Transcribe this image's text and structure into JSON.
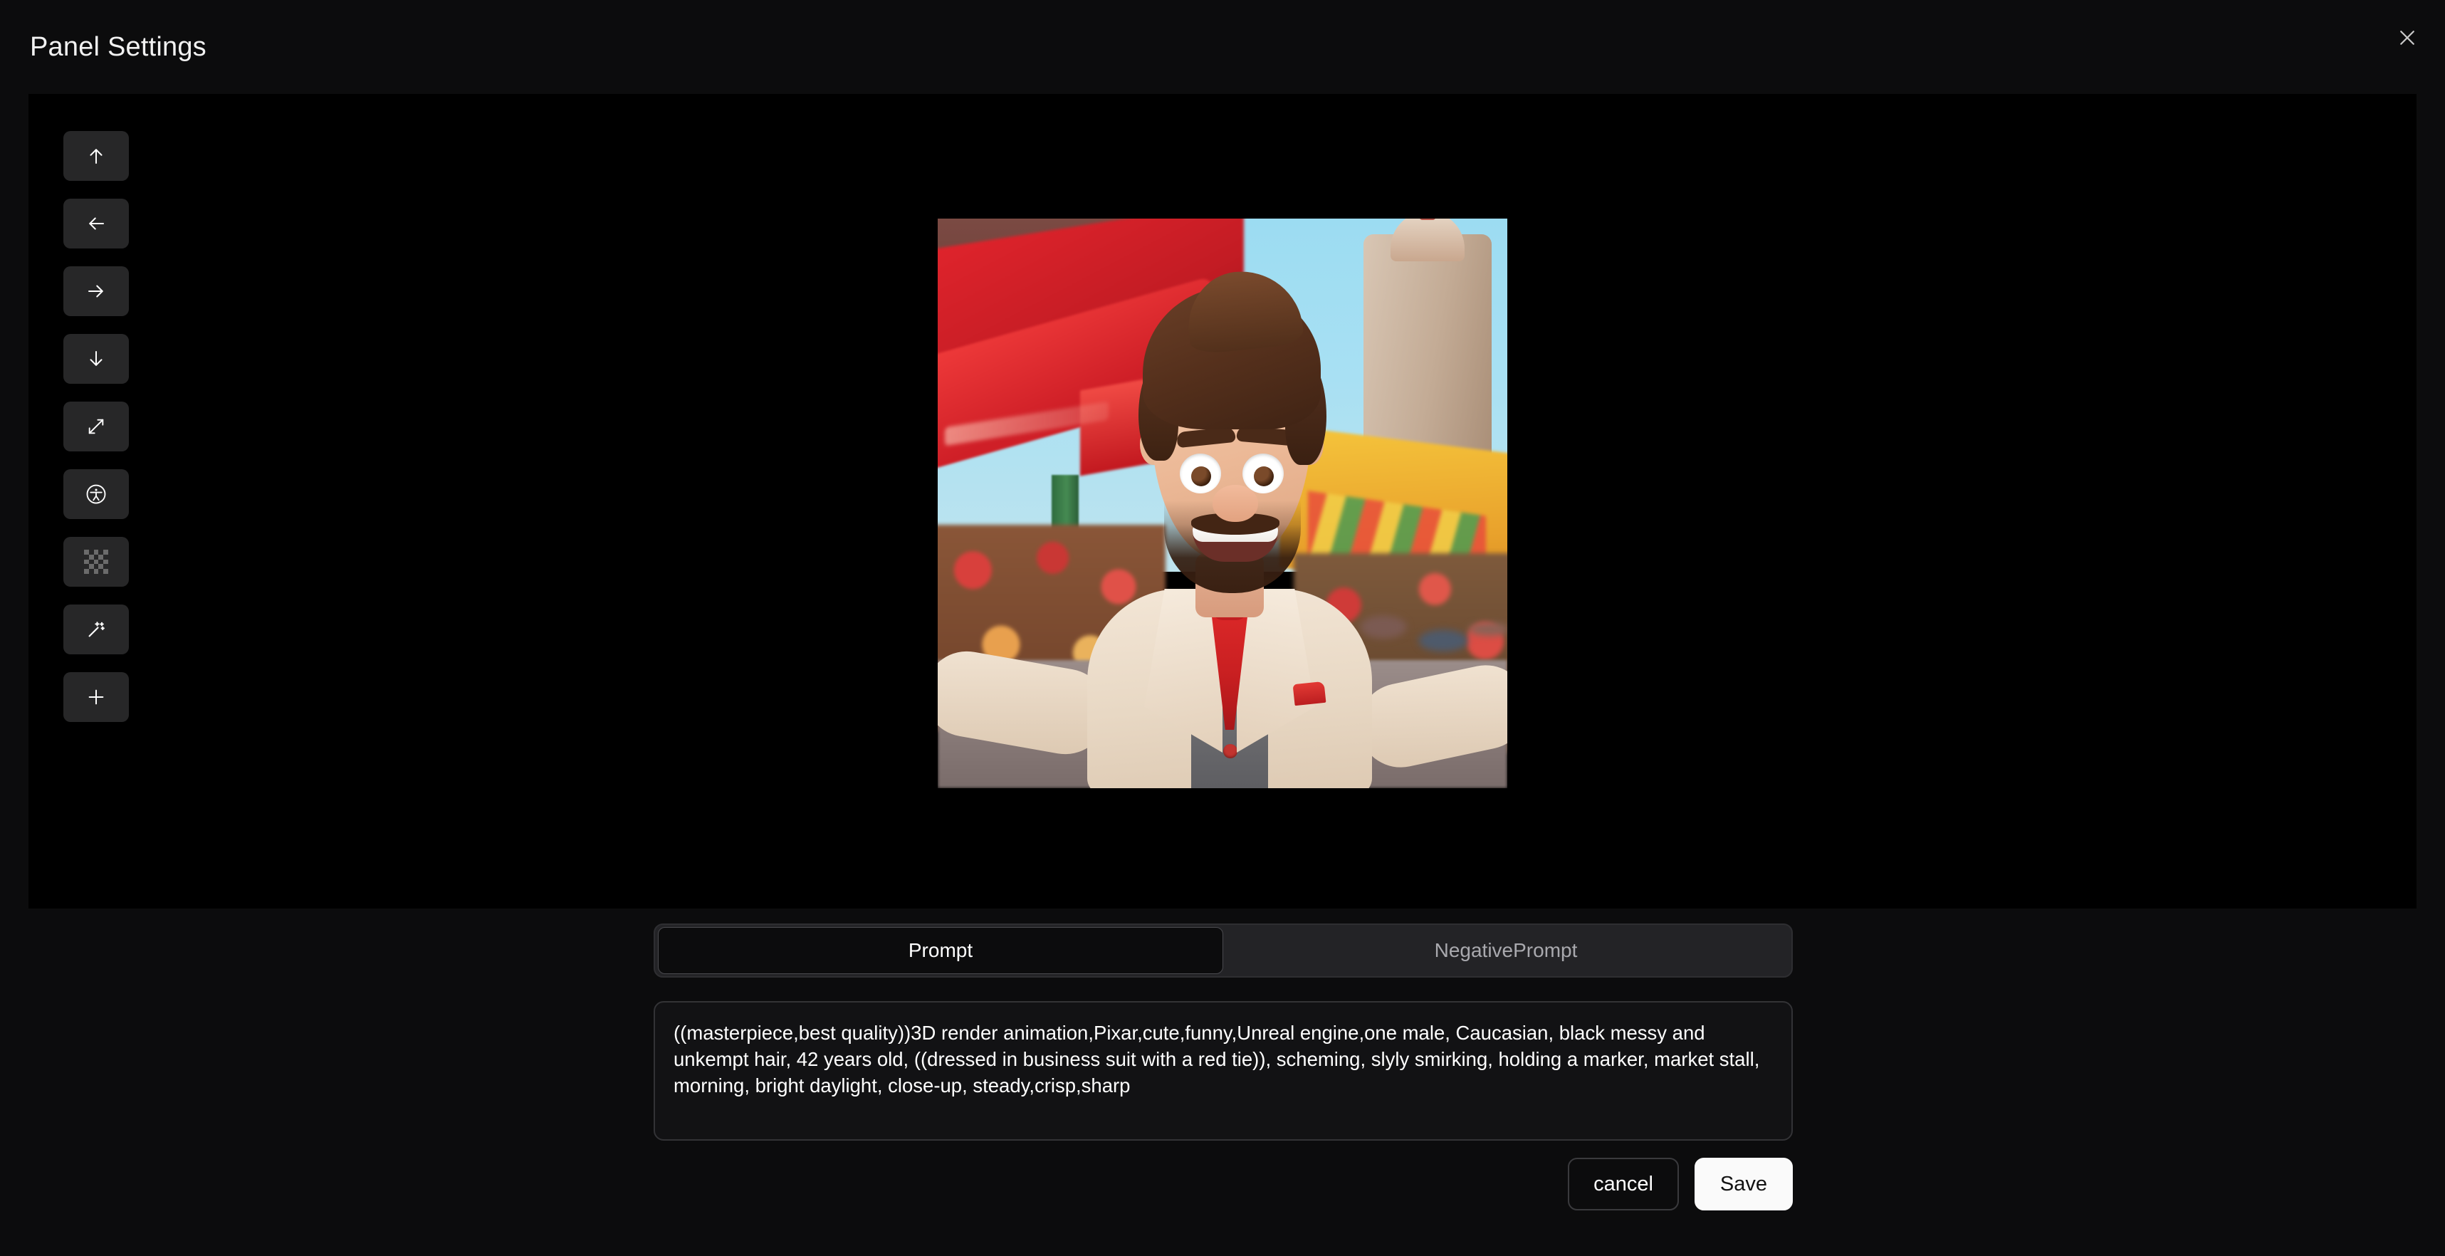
{
  "header": {
    "title": "Panel Settings",
    "close_icon": "close-icon"
  },
  "toolbar": {
    "buttons": [
      {
        "name": "move-up",
        "icon": "arrow-up-icon",
        "label": "Move Up"
      },
      {
        "name": "move-left",
        "icon": "arrow-left-icon",
        "label": "Move Left"
      },
      {
        "name": "move-right",
        "icon": "arrow-right-icon",
        "label": "Move Right"
      },
      {
        "name": "move-down",
        "icon": "arrow-down-icon",
        "label": "Move Down"
      },
      {
        "name": "expand",
        "icon": "expand-diagonal-icon",
        "label": "Expand"
      },
      {
        "name": "accessibility",
        "icon": "accessibility-icon",
        "label": "Accessibility"
      },
      {
        "name": "transparency",
        "icon": "checkerboard-icon",
        "label": "Transparency"
      },
      {
        "name": "magic",
        "icon": "magic-wand-icon",
        "label": "Magic"
      },
      {
        "name": "add",
        "icon": "plus-icon",
        "label": "Add"
      }
    ]
  },
  "canvas": {
    "image_alt": "3D rendered cartoon man in cream business suit with red tie smiling at a market stall",
    "background_color": "#000000"
  },
  "tabs": [
    {
      "label": "Prompt",
      "active": true
    },
    {
      "label": "NegativePrompt",
      "active": false
    }
  ],
  "prompt": {
    "value": "((masterpiece,best quality))3D render animation,Pixar,cute,funny,Unreal engine,one male, Caucasian, black messy and unkempt hair, 42 years old, ((dressed in business suit with a red tie)), scheming, slyly smirking, holding a marker, market stall, morning, bright daylight, close-up, steady,crisp,sharp",
    "placeholder": ""
  },
  "actions": {
    "cancel_label": "cancel",
    "save_label": "Save"
  },
  "colors": {
    "page_background": "#0c0c0d",
    "canvas_background": "#000000",
    "tool_button": "#272728",
    "accent_save": "#fafafa",
    "border": "#333336"
  }
}
